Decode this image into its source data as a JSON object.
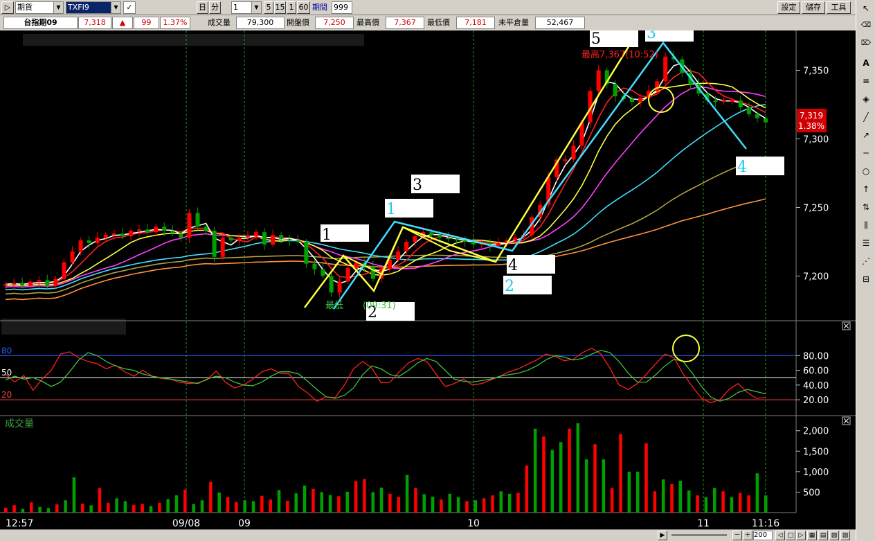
{
  "toolbar": {
    "category": "期貨",
    "symbol": "TXFI9",
    "period_btn_day": "日",
    "period_btn_min": "分",
    "interval_value": "1",
    "interval_options": [
      "5",
      "15",
      "1",
      "60"
    ],
    "period_label": "期間",
    "period_value": "999",
    "settings_label": "設定",
    "save_label": "儲存",
    "tools_label": "工具"
  },
  "quote": {
    "name": "台指期09",
    "price": "7,318",
    "change_arrow": "▲",
    "change": "99",
    "change_pct": "1.37%",
    "volume_label": "成交量",
    "volume": "79,300",
    "open_label": "開盤價",
    "open": "7,250",
    "high_label": "最高價",
    "high": "7,367",
    "low_label": "最低價",
    "low": "7,181",
    "oi_label": "未平倉量",
    "oi": "52,467"
  },
  "chart_labels": {
    "high_marker": "最高7,367(10:52)",
    "low_marker": "最低",
    "low_marker_time": "(09:31)",
    "last_price": "7,319",
    "last_pct": "1.38%",
    "volume_panel_title": "成交量"
  },
  "wave_labels": {
    "yellow": [
      "1",
      "2",
      "3",
      "4",
      "5"
    ],
    "cyan": [
      "1",
      "2",
      "3",
      "4"
    ]
  },
  "colors": {
    "up": "#ff0000",
    "down": "#00a000",
    "ma_white": "#ffffff",
    "ma_yellow": "#ffff40",
    "ma_red": "#ff2020",
    "ma_magenta": "#ff40ff",
    "ma_cyan": "#40e0ff",
    "ma_olive": "#b0a040",
    "ma_orange": "#ff9040",
    "wave_yellow": "#ffff40",
    "wave_cyan": "#40e0ff"
  },
  "chart_data": [
    {
      "type": "candlestick",
      "title": "台指期09",
      "yticks": [
        7200,
        7250,
        7300,
        7350
      ],
      "ylim": [
        7172,
        7378
      ],
      "xticks": [
        "12:57",
        "09/08",
        "09",
        "10",
        "11",
        "11:16"
      ],
      "close_series": [
        7194,
        7195,
        7193,
        7196,
        7197,
        7193,
        7198,
        7210,
        7218,
        7226,
        7224,
        7228,
        7230,
        7231,
        7229,
        7233,
        7234,
        7232,
        7236,
        7233,
        7231,
        7228,
        7246,
        7236,
        7233,
        7214,
        7228,
        7226,
        7228,
        7229,
        7232,
        7223,
        7230,
        7227,
        7226,
        7225,
        7209,
        7205,
        7200,
        7188,
        7196,
        7206,
        7210,
        7207,
        7198,
        7205,
        7212,
        7218,
        7225,
        7229,
        7232,
        7230,
        7228,
        7227,
        7226,
        7225,
        7223,
        7224,
        7222,
        7224,
        7226,
        7228,
        7230,
        7243,
        7252,
        7272,
        7285,
        7285,
        7295,
        7312,
        7335,
        7350,
        7340,
        7331,
        7329,
        7327,
        7330,
        7335,
        7342,
        7360,
        7358,
        7348,
        7340,
        7333,
        7328,
        7327,
        7328,
        7328,
        7323,
        7318,
        7315,
        7312
      ]
    },
    {
      "type": "line",
      "title": "",
      "yticks": [
        20,
        40,
        60,
        80
      ],
      "reference_lines": [
        {
          "label": "80",
          "value": 80
        },
        {
          "label": "50",
          "value": 50
        },
        {
          "label": "20",
          "value": 20
        }
      ],
      "ylim": [
        6,
        100
      ],
      "series": [
        {
          "color": "#ff2020",
          "values": [
            55,
            44,
            53,
            33,
            48,
            60,
            82,
            85,
            77,
            72,
            69,
            62,
            67,
            58,
            52,
            60,
            52,
            49,
            48,
            44,
            42,
            43,
            47,
            59,
            44,
            36,
            40,
            48,
            58,
            62,
            56,
            55,
            38,
            29,
            18,
            24,
            23,
            40,
            62,
            72,
            63,
            43,
            44,
            58,
            70,
            76,
            72,
            55,
            38,
            42,
            48,
            40,
            42,
            47,
            52,
            58,
            62,
            68,
            74,
            82,
            79,
            73,
            75,
            84,
            90,
            82,
            63,
            40,
            34,
            42,
            55,
            69,
            82,
            77,
            55,
            38,
            22,
            16,
            20,
            34,
            42,
            30,
            22,
            23
          ]
        },
        {
          "color": "#40c040",
          "values": [
            47,
            52,
            48,
            50,
            45,
            38,
            44,
            58,
            74,
            84,
            80,
            72,
            66,
            62,
            60,
            55,
            52,
            50,
            48,
            46,
            44,
            42,
            48,
            52,
            50,
            44,
            40,
            39,
            44,
            52,
            58,
            58,
            55,
            45,
            34,
            24,
            22,
            26,
            36,
            54,
            66,
            62,
            54,
            52,
            60,
            70,
            76,
            72,
            60,
            48,
            45,
            44,
            46,
            48,
            52,
            54,
            56,
            60,
            66,
            74,
            80,
            78,
            74,
            76,
            82,
            87,
            84,
            72,
            56,
            44,
            44,
            54,
            66,
            75,
            72,
            56,
            38,
            24,
            18,
            22,
            30,
            34,
            31,
            28
          ]
        }
      ]
    },
    {
      "type": "bar",
      "title": "成交量",
      "yticks": [
        500,
        1000,
        1500,
        2000
      ],
      "ylim": [
        0,
        2300
      ],
      "values": [
        120,
        180,
        90,
        250,
        140,
        110,
        200,
        300,
        860,
        220,
        180,
        600,
        240,
        350,
        280,
        190,
        210,
        160,
        240,
        330,
        420,
        560,
        210,
        300,
        750,
        490,
        380,
        260,
        300,
        280,
        410,
        320,
        550,
        290,
        470,
        660,
        580,
        500,
        430,
        400,
        510,
        770,
        820,
        500,
        610,
        460,
        380,
        920,
        600,
        450,
        390,
        320,
        460,
        380,
        280,
        300,
        350,
        420,
        520,
        460,
        480,
        1150,
        2050,
        1860,
        1530,
        1720,
        2050,
        2180,
        1300,
        1670,
        1300,
        600,
        1920,
        1000,
        1000,
        1690,
        520,
        810,
        700,
        780,
        540,
        420,
        380,
        600,
        520,
        380,
        480,
        420,
        960,
        420
      ]
    }
  ]
}
